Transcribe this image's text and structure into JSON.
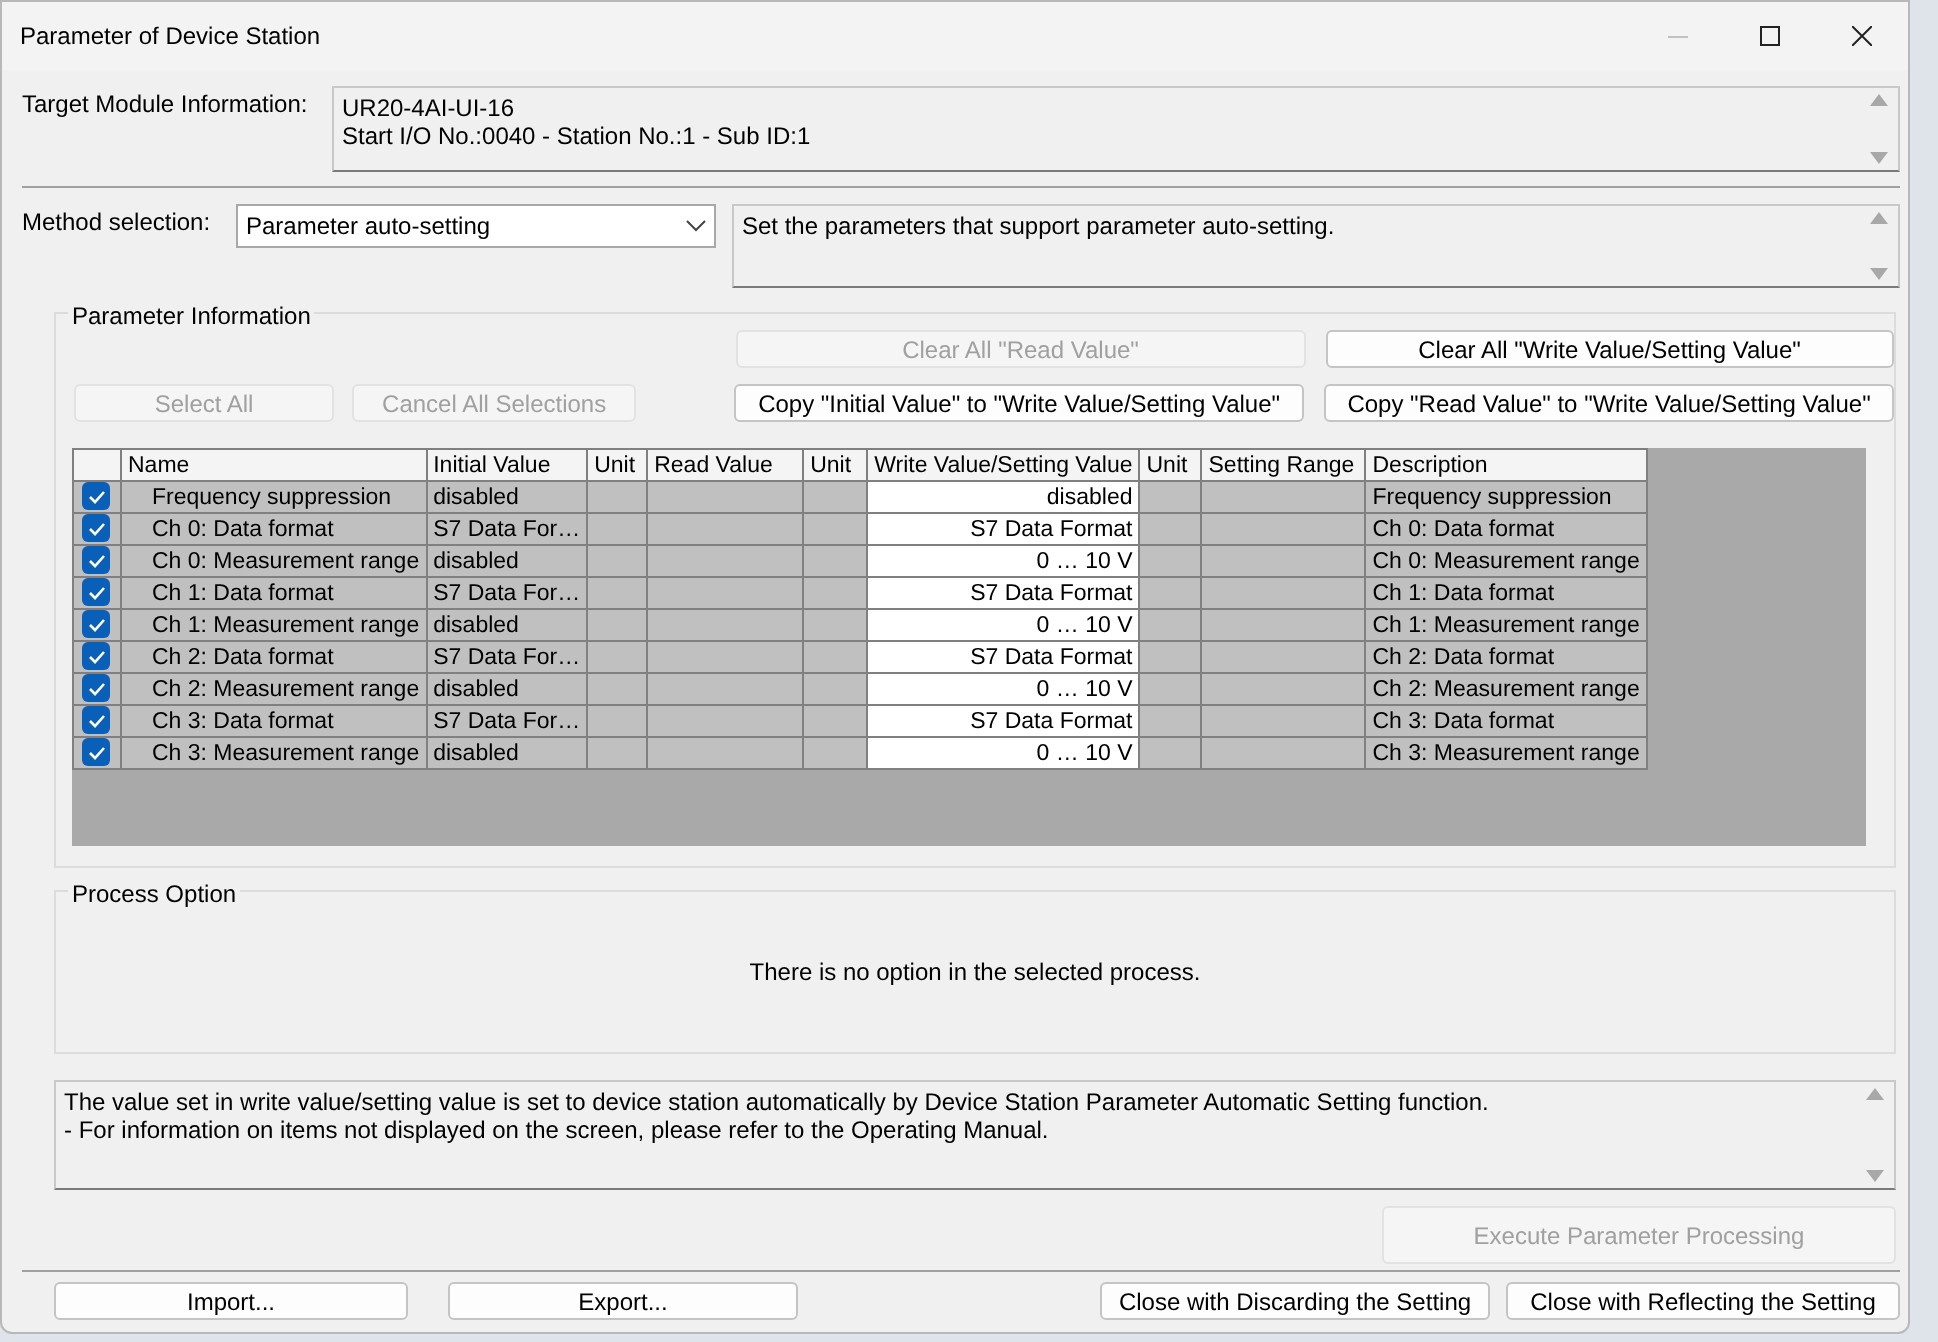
{
  "window": {
    "title": "Parameter of Device Station"
  },
  "target_module": {
    "label": "Target Module Information:",
    "lines": [
      "UR20-4AI-UI-16",
      "Start I/O No.:0040 - Station No.:1 - Sub ID:1"
    ]
  },
  "method": {
    "label": "Method selection:",
    "value": "Parameter auto-setting",
    "description": "Set the parameters that support parameter auto-setting."
  },
  "parameter_information": {
    "title": "Parameter Information",
    "buttons_top": [
      {
        "label": "Clear All \"Read Value\"",
        "disabled": true
      },
      {
        "label": "Clear All \"Write Value/Setting Value\"",
        "disabled": false
      }
    ],
    "buttons_left": [
      {
        "label": "Select All",
        "disabled": true
      },
      {
        "label": "Cancel All Selections",
        "disabled": true
      }
    ],
    "buttons_copy": [
      {
        "label": "Copy \"Initial Value\" to \"Write Value/Setting Value\"",
        "disabled": false
      },
      {
        "label": "Copy \"Read Value\" to \"Write Value/Setting Value\"",
        "disabled": false
      }
    ],
    "table": {
      "columns": [
        "Name",
        "Initial Value",
        "Unit",
        "Read Value",
        "Unit",
        "Write Value/Setting Value",
        "Unit",
        "Setting Range",
        "Description"
      ],
      "rows": [
        {
          "checked": true,
          "name": "Frequency suppression",
          "initial_value": "disabled",
          "write_value": "disabled",
          "description": "Frequency suppression"
        },
        {
          "checked": true,
          "name": "Ch 0: Data format",
          "initial_value": "S7 Data For…",
          "write_value": "S7 Data Format",
          "description": "Ch 0: Data format"
        },
        {
          "checked": true,
          "name": "Ch 0: Measurement range",
          "initial_value": "disabled",
          "write_value": "0 … 10 V",
          "description": "Ch 0: Measurement range"
        },
        {
          "checked": true,
          "name": "Ch 1: Data format",
          "initial_value": "S7 Data For…",
          "write_value": "S7 Data Format",
          "description": "Ch 1: Data format"
        },
        {
          "checked": true,
          "name": "Ch 1: Measurement range",
          "initial_value": "disabled",
          "write_value": "0 … 10 V",
          "description": "Ch 1: Measurement range"
        },
        {
          "checked": true,
          "name": "Ch 2: Data format",
          "initial_value": "S7 Data For…",
          "write_value": "S7 Data Format",
          "description": "Ch 2: Data format"
        },
        {
          "checked": true,
          "name": "Ch 2: Measurement range",
          "initial_value": "disabled",
          "write_value": "0 … 10 V",
          "description": "Ch 2: Measurement range"
        },
        {
          "checked": true,
          "name": "Ch 3: Data format",
          "initial_value": "S7 Data For…",
          "write_value": "S7 Data Format",
          "description": "Ch 3: Data format"
        },
        {
          "checked": true,
          "name": "Ch 3: Measurement range",
          "initial_value": "disabled",
          "write_value": "0 … 10 V",
          "description": "Ch 3: Measurement range"
        }
      ]
    }
  },
  "process_option": {
    "title": "Process Option",
    "message": "There is no option in the selected process."
  },
  "message": {
    "lines": [
      "The value set in write value/setting value is set to device station automatically by Device Station Parameter Automatic Setting function.",
      "- For information on items not displayed on the screen, please refer to the Operating Manual."
    ]
  },
  "execute_button": {
    "label": "Execute Parameter Processing",
    "disabled": true
  },
  "footer_buttons_left": [
    {
      "label": "Import...",
      "disabled": false
    },
    {
      "label": "Export...",
      "disabled": false
    }
  ],
  "footer_buttons_right": [
    {
      "label": "Close with Discarding the Setting",
      "disabled": false
    },
    {
      "label": "Close with Reflecting the Setting",
      "disabled": false
    }
  ]
}
